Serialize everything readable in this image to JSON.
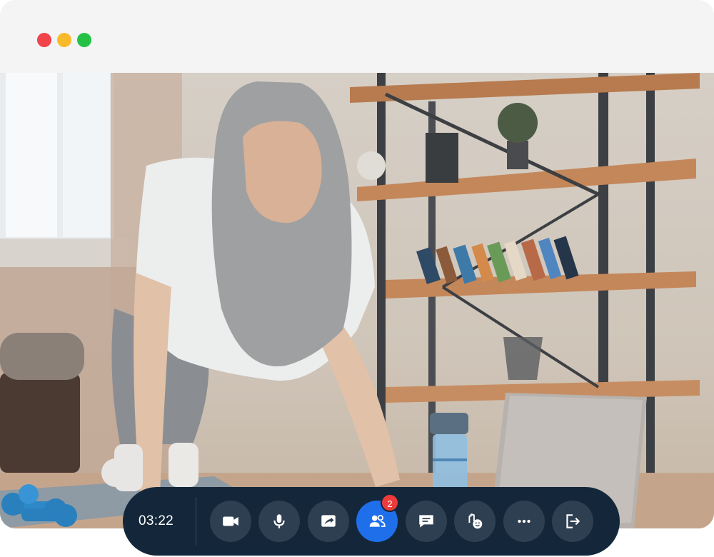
{
  "window": {
    "traffic_lights": {
      "close": "#f0434a",
      "minimize": "#f8ba2a",
      "maximize": "#24c244"
    }
  },
  "call": {
    "elapsed": "03:22",
    "participants_badge": "2"
  },
  "controls": [
    {
      "id": "camera",
      "icon": "video-camera-icon",
      "active": false
    },
    {
      "id": "microphone",
      "icon": "microphone-icon",
      "active": false
    },
    {
      "id": "share-screen",
      "icon": "share-screen-icon",
      "active": false
    },
    {
      "id": "participants",
      "icon": "participants-icon",
      "active": true
    },
    {
      "id": "chat",
      "icon": "chat-icon",
      "active": false
    },
    {
      "id": "reactions",
      "icon": "raise-hand-emoji-icon",
      "active": false
    },
    {
      "id": "more",
      "icon": "more-options-icon",
      "active": false
    },
    {
      "id": "leave",
      "icon": "leave-call-icon",
      "active": false
    }
  ],
  "colors": {
    "control_bar": "#14273a",
    "control_button": "#2e3f52",
    "active_button": "#1f6feb",
    "badge": "#ec3b3b"
  }
}
